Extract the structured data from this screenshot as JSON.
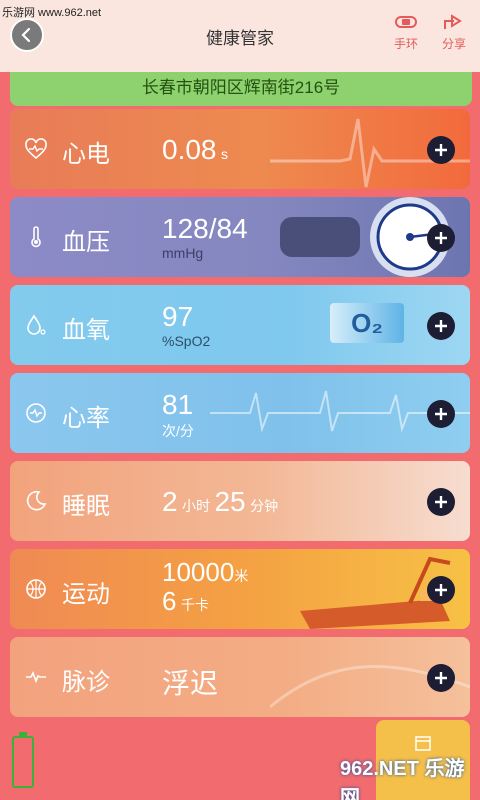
{
  "watermark_top": "乐游网 www.962.net",
  "header": {
    "title": "健康管家",
    "band_label": "手环",
    "share_label": "分享"
  },
  "address": "长春市朝阳区辉南街216号",
  "cards": [
    {
      "name": "心电",
      "value": "0.08",
      "unit": "s",
      "icon": "heart-ecg-icon"
    },
    {
      "name": "血压",
      "value": "128/84",
      "unit": "mmHg",
      "icon": "thermometer-icon"
    },
    {
      "name": "血氧",
      "value": "97",
      "unit": "%SpO2",
      "badge": "O₂",
      "icon": "droplet-icon"
    },
    {
      "name": "心率",
      "value": "81",
      "unit": "次/分",
      "icon": "pulse-icon"
    },
    {
      "name": "睡眠",
      "hours": "2",
      "hours_unit": "小时",
      "minutes": "25",
      "minutes_unit": "分钟",
      "icon": "moon-icon"
    },
    {
      "name": "运动",
      "distance": "10000",
      "distance_unit": "米",
      "calories": "6",
      "calories_unit": "千卡",
      "icon": "basketball-icon"
    },
    {
      "name": "脉诊",
      "value": "浮迟",
      "icon": "pulse-line-icon"
    }
  ],
  "brand_watermark": "962.NET 乐游网"
}
